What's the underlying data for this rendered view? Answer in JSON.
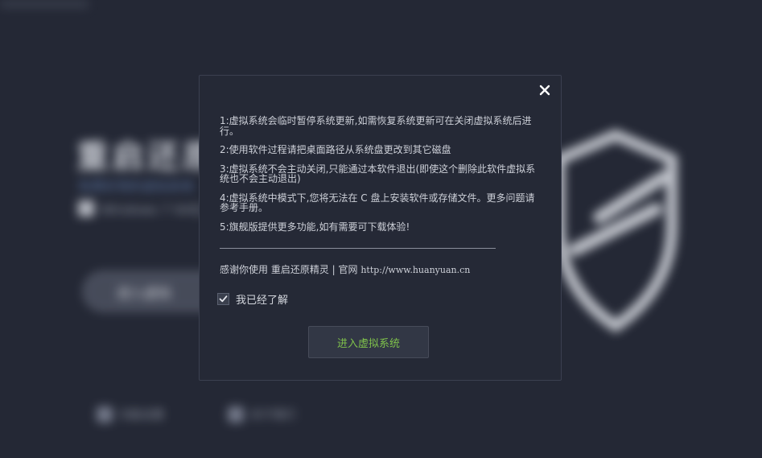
{
  "background": {
    "title": "重启还原",
    "subtitle": "免费好用的虚拟系统",
    "os_text": "Windows 7 64位",
    "main_button": "进入虚拟",
    "bottom_left": "功能设置",
    "bottom_right": "关于我们"
  },
  "dialog": {
    "notices": [
      "1:虚拟系统会临时暂停系统更新,如需恢复系统更新可在关闭虚拟系统后进行。",
      "2:使用软件过程请把桌面路径从系统盘更改到其它磁盘",
      "3:虚拟系统不会主动关闭,只能通过本软件退出(即使这个删除此软件虚拟系统也不会主动退出)",
      "4:虚拟系统中模式下,您将无法在 C 盘上安装软件或存储文件。更多问题请参考手册。",
      "5:旗舰版提供更多功能,如有需要可下载体验!"
    ],
    "thanks_prefix": "感谢你使用 重启还原精灵 | 官网",
    "thanks_url": "http://www.huanyuan.cn",
    "agree_label": "我已经了解",
    "agree_checked": true,
    "enter_button": "进入虚拟系统",
    "accent_color": "#7fc24b"
  },
  "icons": {
    "close": "close-icon",
    "check": "checkmark-icon"
  }
}
